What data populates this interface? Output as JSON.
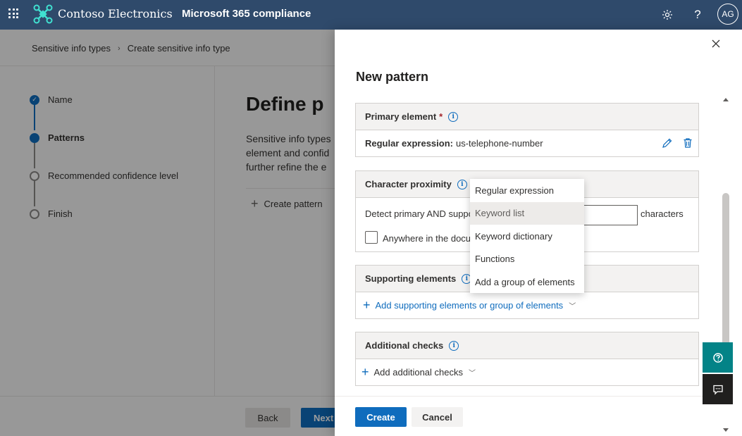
{
  "topbar": {
    "brand_name": "Contoso Electronics",
    "app_name": "Microsoft 365 compliance",
    "settings_icon": "gear-icon",
    "help_icon": "question-icon",
    "help_glyph": "?",
    "avatar_initials": "AG",
    "color": "#2f4a6b"
  },
  "breadcrumb": {
    "items": [
      "Sensitive info types",
      "Create sensitive info type"
    ],
    "separator": "›"
  },
  "wizard": {
    "steps": [
      {
        "label": "Name",
        "state": "done"
      },
      {
        "label": "Patterns",
        "state": "active"
      },
      {
        "label": "Recommended confidence level",
        "state": "todo"
      },
      {
        "label": "Finish",
        "state": "todo"
      }
    ]
  },
  "main": {
    "title": "Define p",
    "description_lines": [
      "Sensitive info types",
      "element and confid",
      "further refine the e"
    ],
    "create_pattern_label": "Create pattern",
    "back_label": "Back",
    "next_label": "Next"
  },
  "panel": {
    "title": "New pattern",
    "primary_element": {
      "header": "Primary element",
      "required_mark": "*",
      "regex_label": "Regular expression:",
      "regex_value": "us-telephone-number"
    },
    "character_proximity": {
      "header": "Character proximity",
      "detect_text": "Detect primary AND suppo",
      "input_value": "",
      "characters_label": "characters",
      "anywhere_label": "Anywhere in the docu",
      "anywhere_checked": false
    },
    "supporting_elements": {
      "header": "Supporting elements",
      "add_link": "Add supporting elements or group of elements"
    },
    "additional_checks": {
      "header": "Additional checks",
      "add_link": "Add additional checks"
    },
    "create_label": "Create",
    "cancel_label": "Cancel"
  },
  "dropdown_menu": {
    "items": [
      "Regular expression",
      "Keyword list",
      "Keyword dictionary",
      "Functions",
      "Add a group of elements"
    ],
    "hovered_index": 1
  },
  "colors": {
    "accent": "#0f6cbd",
    "help_button": "#038387",
    "feedback_button": "#201f1e",
    "required": "#a4262c"
  }
}
